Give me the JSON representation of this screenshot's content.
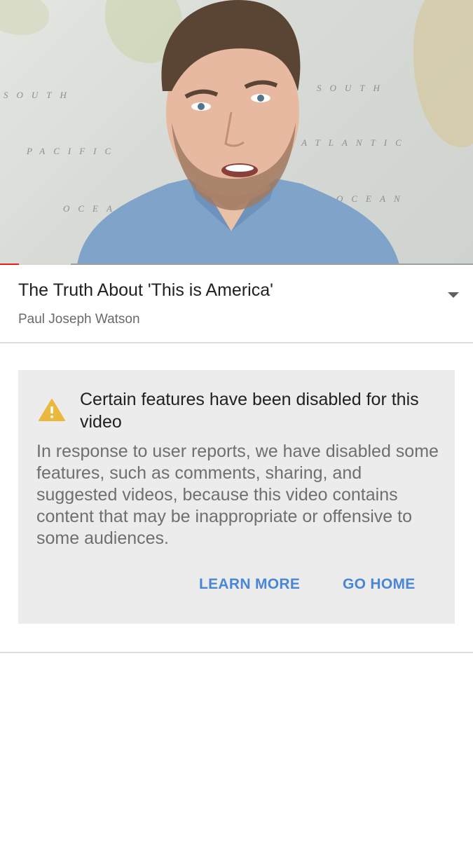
{
  "player": {
    "progress_played_fraction": 0.04,
    "progress_buffered_fraction": 0.15,
    "progress_color": "#e62117"
  },
  "video": {
    "title": "The Truth About 'This is America'",
    "channel": "Paul Joseph Watson",
    "expand_icon": "chevron-down-icon"
  },
  "notice": {
    "icon": "warning-icon",
    "icon_color": "#e8b93c",
    "title": "Certain features have been disabled for this video",
    "body": "In response to user reports, we have disabled some features, such as comments, sharing, and suggested videos, because this video contains content that may be inappropriate or offensive to some audiences.",
    "learn_more_label": "LEARN MORE",
    "go_home_label": "GO HOME",
    "accent_color": "#4a86d6"
  }
}
